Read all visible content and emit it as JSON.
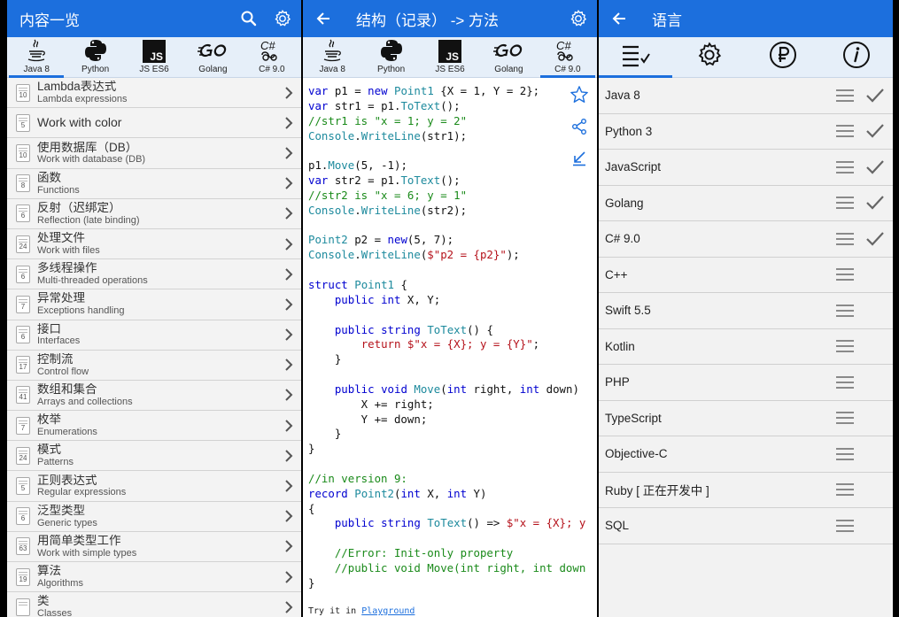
{
  "panel1": {
    "title": "内容一览",
    "tabs": [
      {
        "label": "Java 8",
        "icon": "java-icon"
      },
      {
        "label": "Python",
        "icon": "python-icon"
      },
      {
        "label": "JS ES6",
        "icon": "js-icon"
      },
      {
        "label": "Golang",
        "icon": "go-icon"
      },
      {
        "label": "C# 9.0",
        "icon": "csharp-icon"
      }
    ],
    "active_tab": 0,
    "items": [
      {
        "count": "10",
        "title": "Lambda表达式",
        "subtitle": "Lambda expressions"
      },
      {
        "count": "5",
        "title": "Work with color",
        "subtitle": ""
      },
      {
        "count": "10",
        "title": "使用数据库（DB）",
        "subtitle": "Work with database (DB)"
      },
      {
        "count": "8",
        "title": "函数",
        "subtitle": "Functions"
      },
      {
        "count": "6",
        "title": "反射（迟绑定）",
        "subtitle": "Reflection (late binding)"
      },
      {
        "count": "24",
        "title": "处理文件",
        "subtitle": "Work with files"
      },
      {
        "count": "6",
        "title": "多线程操作",
        "subtitle": "Multi-threaded operations"
      },
      {
        "count": "7",
        "title": "异常处理",
        "subtitle": "Exceptions handling"
      },
      {
        "count": "6",
        "title": "接口",
        "subtitle": "Interfaces"
      },
      {
        "count": "17",
        "title": "控制流",
        "subtitle": "Control flow"
      },
      {
        "count": "41",
        "title": "数组和集合",
        "subtitle": "Arrays and collections"
      },
      {
        "count": "7",
        "title": "枚举",
        "subtitle": "Enumerations"
      },
      {
        "count": "24",
        "title": "模式",
        "subtitle": "Patterns"
      },
      {
        "count": "5",
        "title": "正则表达式",
        "subtitle": "Regular expressions"
      },
      {
        "count": "6",
        "title": "泛型类型",
        "subtitle": "Generic types"
      },
      {
        "count": "63",
        "title": "用简单类型工作",
        "subtitle": "Work with simple types"
      },
      {
        "count": "19",
        "title": "算法",
        "subtitle": "Algorithms"
      },
      {
        "count": "",
        "title": "类",
        "subtitle": "Classes"
      }
    ]
  },
  "panel2": {
    "title": "结构（记录） -> 方法",
    "tabs": [
      {
        "label": "Java 8",
        "icon": "java-icon"
      },
      {
        "label": "Python",
        "icon": "python-icon"
      },
      {
        "label": "JS ES6",
        "icon": "js-icon"
      },
      {
        "label": "Golang",
        "icon": "go-icon"
      },
      {
        "label": "C# 9.0",
        "icon": "csharp-icon"
      }
    ],
    "active_tab": 4,
    "code_lines": [
      [
        [
          "kw",
          "var"
        ],
        [
          "nm",
          " p1 = "
        ],
        [
          "kw",
          "new"
        ],
        [
          "nm",
          " "
        ],
        [
          "ty",
          "Point1"
        ],
        [
          "nm",
          " {X = 1, Y = 2};"
        ]
      ],
      [
        [
          "kw",
          "var"
        ],
        [
          "nm",
          " str1 = p1."
        ],
        [
          "ty",
          "ToText"
        ],
        [
          "nm",
          "();"
        ]
      ],
      [
        [
          "cm",
          "//str1 is \"x = 1; y = 2\""
        ]
      ],
      [
        [
          "ty",
          "Console"
        ],
        [
          "nm",
          "."
        ],
        [
          "ty",
          "WriteLine"
        ],
        [
          "nm",
          "(str1);"
        ]
      ],
      [
        [
          "nm",
          ""
        ]
      ],
      [
        [
          "nm",
          "p1."
        ],
        [
          "ty",
          "Move"
        ],
        [
          "nm",
          "(5, -1);"
        ]
      ],
      [
        [
          "kw",
          "var"
        ],
        [
          "nm",
          " str2 = p1."
        ],
        [
          "ty",
          "ToText"
        ],
        [
          "nm",
          "();"
        ]
      ],
      [
        [
          "cm",
          "//str2 is \"x = 6; y = 1\""
        ]
      ],
      [
        [
          "ty",
          "Console"
        ],
        [
          "nm",
          "."
        ],
        [
          "ty",
          "WriteLine"
        ],
        [
          "nm",
          "(str2);"
        ]
      ],
      [
        [
          "nm",
          ""
        ]
      ],
      [
        [
          "ty",
          "Point2"
        ],
        [
          "nm",
          " p2 = "
        ],
        [
          "kw",
          "new"
        ],
        [
          "nm",
          "(5, 7);"
        ]
      ],
      [
        [
          "ty",
          "Console"
        ],
        [
          "nm",
          "."
        ],
        [
          "ty",
          "WriteLine"
        ],
        [
          "nm",
          "("
        ],
        [
          "st",
          "$\"p2 = {p2}\""
        ],
        [
          "nm",
          ");"
        ]
      ],
      [
        [
          "nm",
          ""
        ]
      ],
      [
        [
          "kw",
          "struct"
        ],
        [
          "nm",
          " "
        ],
        [
          "ty",
          "Point1"
        ],
        [
          "nm",
          " {"
        ]
      ],
      [
        [
          "nm",
          "    "
        ],
        [
          "kw",
          "public"
        ],
        [
          "nm",
          " "
        ],
        [
          "kw",
          "int"
        ],
        [
          "nm",
          " X, Y;"
        ]
      ],
      [
        [
          "nm",
          ""
        ]
      ],
      [
        [
          "nm",
          "    "
        ],
        [
          "kw",
          "public"
        ],
        [
          "nm",
          " "
        ],
        [
          "kw",
          "string"
        ],
        [
          "nm",
          " "
        ],
        [
          "ty",
          "ToText"
        ],
        [
          "nm",
          "() {"
        ]
      ],
      [
        [
          "nm",
          "        "
        ],
        [
          "st",
          "return"
        ],
        [
          "nm",
          " "
        ],
        [
          "st",
          "$\"x = {X}; y = {Y}\""
        ],
        [
          "nm",
          ";"
        ]
      ],
      [
        [
          "nm",
          "    }"
        ]
      ],
      [
        [
          "nm",
          ""
        ]
      ],
      [
        [
          "nm",
          "    "
        ],
        [
          "kw",
          "public"
        ],
        [
          "nm",
          " "
        ],
        [
          "kw",
          "void"
        ],
        [
          "nm",
          " "
        ],
        [
          "ty",
          "Move"
        ],
        [
          "nm",
          "("
        ],
        [
          "kw",
          "int"
        ],
        [
          "nm",
          " right, "
        ],
        [
          "kw",
          "int"
        ],
        [
          "nm",
          " down)"
        ]
      ],
      [
        [
          "nm",
          "        X += right;"
        ]
      ],
      [
        [
          "nm",
          "        Y += down;"
        ]
      ],
      [
        [
          "nm",
          "    }"
        ]
      ],
      [
        [
          "nm",
          "}"
        ]
      ],
      [
        [
          "nm",
          ""
        ]
      ],
      [
        [
          "cm",
          "//in version 9:"
        ]
      ],
      [
        [
          "kw",
          "record"
        ],
        [
          "nm",
          " "
        ],
        [
          "ty",
          "Point2"
        ],
        [
          "nm",
          "("
        ],
        [
          "kw",
          "int"
        ],
        [
          "nm",
          " X, "
        ],
        [
          "kw",
          "int"
        ],
        [
          "nm",
          " Y)"
        ]
      ],
      [
        [
          "nm",
          "{"
        ]
      ],
      [
        [
          "nm",
          "    "
        ],
        [
          "kw",
          "public"
        ],
        [
          "nm",
          " "
        ],
        [
          "kw",
          "string"
        ],
        [
          "nm",
          " "
        ],
        [
          "ty",
          "ToText"
        ],
        [
          "nm",
          "() => "
        ],
        [
          "st",
          "$\"x = {X}; y"
        ]
      ],
      [
        [
          "nm",
          ""
        ]
      ],
      [
        [
          "cm",
          "    //Error: Init-only property"
        ]
      ],
      [
        [
          "cm",
          "    //public void Move(int right, int down"
        ]
      ],
      [
        [
          "nm",
          "}"
        ]
      ]
    ],
    "try_prefix": "Try it in ",
    "try_link": "Playground",
    "side_icons": [
      "star-icon",
      "share-icon",
      "collapse-icon"
    ]
  },
  "panel3": {
    "title": "语言",
    "tabs": [
      "list-check-icon",
      "gear-icon",
      "ruble-icon",
      "info-icon"
    ],
    "active_tab": 0,
    "languages": [
      {
        "name": "Java 8",
        "checked": true
      },
      {
        "name": "Python 3",
        "checked": true
      },
      {
        "name": "JavaScript",
        "checked": true
      },
      {
        "name": "Golang",
        "checked": true
      },
      {
        "name": "C# 9.0",
        "checked": true
      },
      {
        "name": "C++",
        "checked": false
      },
      {
        "name": "Swift 5.5",
        "checked": false
      },
      {
        "name": "Kotlin",
        "checked": false
      },
      {
        "name": "PHP",
        "checked": false
      },
      {
        "name": "TypeScript",
        "checked": false
      },
      {
        "name": "Objective-C",
        "checked": false
      },
      {
        "name": "Ruby [ 正在开发中 ]",
        "checked": false
      },
      {
        "name": "SQL",
        "checked": false
      }
    ]
  },
  "colors": {
    "accent": "#1c6fdd",
    "tab_bar": "#e6eff9",
    "keyword": "#0000d0",
    "type": "#1d8a9d",
    "comment": "#1a8a1a",
    "string": "#b5121b"
  }
}
